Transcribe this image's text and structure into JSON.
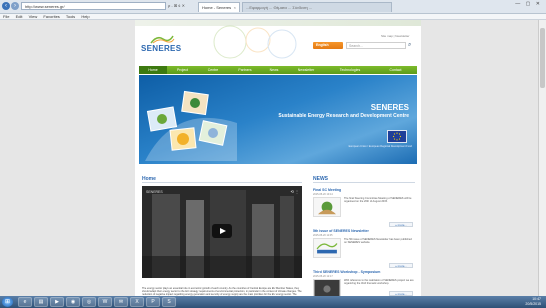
{
  "browser": {
    "address": "http://www.seneres.gr/",
    "address_controls": "ρ - ⊠ ¢ ✕",
    "tab_active": "Home - Seneres",
    "tab_inactive": "...Εφαρμογή ... Θέματα ... Σύνδεση ...",
    "window_controls": "— ▢ ✕",
    "menu": [
      "File",
      "Edit",
      "View",
      "Favorites",
      "Tools",
      "Help"
    ]
  },
  "site": {
    "logo": "SENERES",
    "top_links": "Site map | Newsletter",
    "lang_button": "English",
    "search_placeholder": "Search...",
    "nav": [
      "Home",
      "Project",
      "Centre",
      "Partners",
      "News",
      "Newsletter",
      "Technologies",
      "Contact"
    ],
    "banner_title": "SENERES",
    "banner_subtitle": "Sustainable Energy Research and Development Centre",
    "eu_caption": "European Union / European Regional Development Fund"
  },
  "content": {
    "home_title": "Home",
    "news_title": "NEWS",
    "video_logo": "SENERES",
    "video_controls": "⟲ ⋮",
    "intro_text": "The energy sector plays an essential role in economic growth of each country. As the countries of Central Europe are EU Member States, they should adapt their energy sector to the EU strategy requirements of environmental protection, in particular in the context of climate changes. The reduction of negative impact regarding energy generation and security of energy supply are the main priorities for the EU energy sector. The major EU targets are formulated in the EU SET Plan.",
    "news": [
      {
        "title": "Final SC Meeting",
        "date": "2015-05-20 10:14",
        "text": "The final Steering Committee Meeting of SENERES will be organised on the 20th of August 2015.",
        "more": "» more..."
      },
      {
        "title": "5th issue of SENERES Newsletter",
        "date": "2015-05-20 11:05",
        "text": "The 5th issue of SENERES Newsletter has been published on SENERES website.",
        "more": "» more..."
      },
      {
        "title": "Third SENERES Workshop - Symposium",
        "date": "2015-05-20 12:17",
        "text": "With reference to the realization of SENERES project we are organizing the third thematic workshop.",
        "more": "» more..."
      }
    ]
  },
  "taskbar": {
    "time": "10:47",
    "date": "20/5/2015"
  }
}
